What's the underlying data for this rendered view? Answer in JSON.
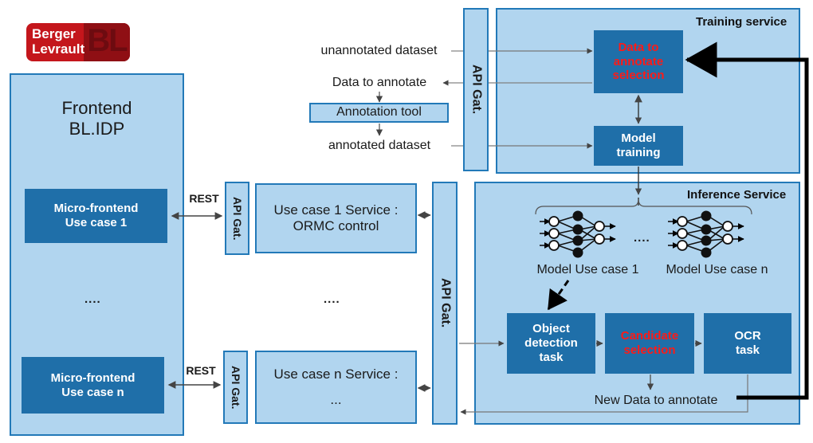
{
  "logo": {
    "line1": "Berger",
    "line2": "Levrault",
    "mark": "BL",
    "brand_color": "#c4161c"
  },
  "colors": {
    "panel_fill": "#b1d5ef",
    "panel_border": "#2279b8",
    "box_fill": "#1f6fa9",
    "highlight_text": "#ff1a17",
    "connector": "#595959",
    "feedback_line": "#000000"
  },
  "frontend": {
    "title_line1": "Frontend",
    "title_line2": "BL.IDP",
    "microfrontend_1": "Micro-frontend\nUse case 1",
    "microfrontend_1_line1": "Micro-frontend",
    "microfrontend_1_line2": "Use case 1",
    "microfrontend_n_line1": "Micro-frontend",
    "microfrontend_n_line2": "Use case n",
    "ellipsis": "...."
  },
  "gateways": {
    "uc1_label": "API Gat.",
    "ucn_label": "API Gat.",
    "services_label": "API Gat.",
    "training_label": "API Gat."
  },
  "connectors": {
    "rest_top": "REST",
    "rest_bottom": "REST"
  },
  "services": {
    "use_case_1_line1": "Use case 1 Service :",
    "use_case_1_line2": "ORMC control",
    "use_case_n_line1": "Use case n Service :",
    "use_case_n_line2": "...",
    "ellipsis": "...."
  },
  "annotation_flow": {
    "unannotated_dataset": "unannotated dataset",
    "data_to_annotate": "Data to annotate",
    "annotation_tool": "Annotation tool",
    "annotated_dataset": "annotated dataset"
  },
  "training_service": {
    "title": "Training service",
    "data_selection_line1": "Data to",
    "data_selection_line2": "annotate",
    "data_selection_line3": "selection",
    "model_training_line1": "Model",
    "model_training_line2": "training"
  },
  "inference_service": {
    "title": "Inference Service",
    "model_1_label": "Model Use case 1",
    "model_n_label": "Model Use case n",
    "models_ellipsis": "....",
    "object_detection_line1": "Object",
    "object_detection_line2": "detection",
    "object_detection_line3": "task",
    "candidate_selection_line1": "Candidate",
    "candidate_selection_line2": "selection",
    "ocr_line1": "OCR",
    "ocr_line2": "task",
    "new_data_to_annotate": "New Data to annotate"
  }
}
